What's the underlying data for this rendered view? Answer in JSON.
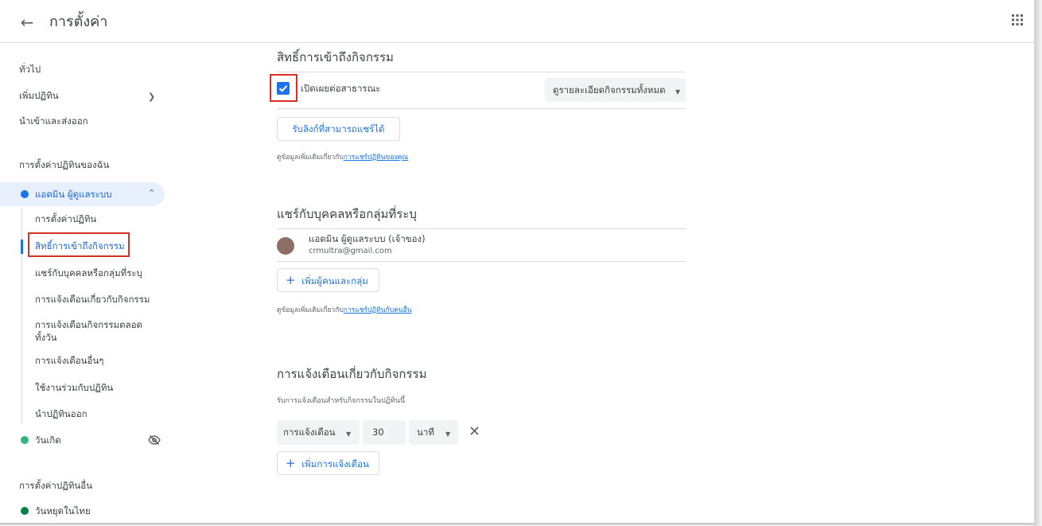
{
  "header": {
    "back_icon": "arrow-left-icon",
    "title": "การตั้งค่า",
    "apps_icon": "apps-grid-icon"
  },
  "sidebar": {
    "general": "ทั่วไป",
    "add_calendar": "เพิ่มปฏิทิน",
    "import_export": "นำเข้าและส่งออก",
    "my_calendars_heading": "การตั้งค่าปฏิทินของฉัน",
    "admin_calendar": {
      "label": "แอดมิน ผู้ดูแลระบบ",
      "color": "#1a73e8"
    },
    "sub_items": [
      "การตั้งค่าปฏิทิน",
      "สิทธิ์การเข้าถึงกิจกรรม",
      "แชร์กับบุคคลหรือกลุ่มที่ระบุ",
      "การแจ้งเตือนเกี่ยวกับกิจกรรม",
      "การแจ้งเตือนกิจกรรมตลอดทั้งวัน",
      "การแจ้งเตือนอื่นๆ",
      "ใช้งานร่วมกับปฏิทิน",
      "นำปฏิทินออก"
    ],
    "birthday": {
      "label": "วันเกิด",
      "color": "#33b679",
      "icon": "visibility-off-icon"
    },
    "other_calendars_heading": "การตั้งค่าปฏิทินอื่น",
    "thai_holidays": {
      "label": "วันหยุดในไทย",
      "color": "#0b8043"
    }
  },
  "access": {
    "title": "สิทธิ์การเข้าถึงกิจกรรม",
    "public_label": "เปิดเผยต่อสาธารณะ",
    "public_checked": true,
    "visibility_select": "ดูรายละเอียดกิจกรรมทั้งหมด",
    "share_link_button": "รับลิงก์ที่สามารถแชร์ได้",
    "help_prefix": "ดูข้อมูลเพิ่มเติมเกี่ยวกับ",
    "help_link": "การแชร์ปฏิทินของคุณ"
  },
  "share": {
    "title": "แชร์กับบุคคลหรือกลุ่มที่ระบุ",
    "owner_name": "แอดมิน ผู้ดูแลระบบ (เจ้าของ)",
    "owner_email": "crmultra@gmail.com",
    "add_people_button": "เพิ่มผู้คนและกลุ่ม",
    "help_prefix": "ดูข้อมูลเพิ่มเติมเกี่ยวกับ",
    "help_link": "การแชร์ปฏิทินกับคนอื่น"
  },
  "notifications": {
    "title": "การแจ้งเตือนเกี่ยวกับกิจกรรม",
    "subtitle": "รับการแจ้งเตือนสำหรับกิจกรรมในปฏิทินนี้",
    "type_select": "การแจ้งเตือน",
    "amount": "30",
    "unit_select": "นาที",
    "add_button": "เพิ่มการแจ้งเตือน"
  },
  "colors": {
    "accent": "#1a73e8",
    "highlight_box": "#d93025"
  }
}
